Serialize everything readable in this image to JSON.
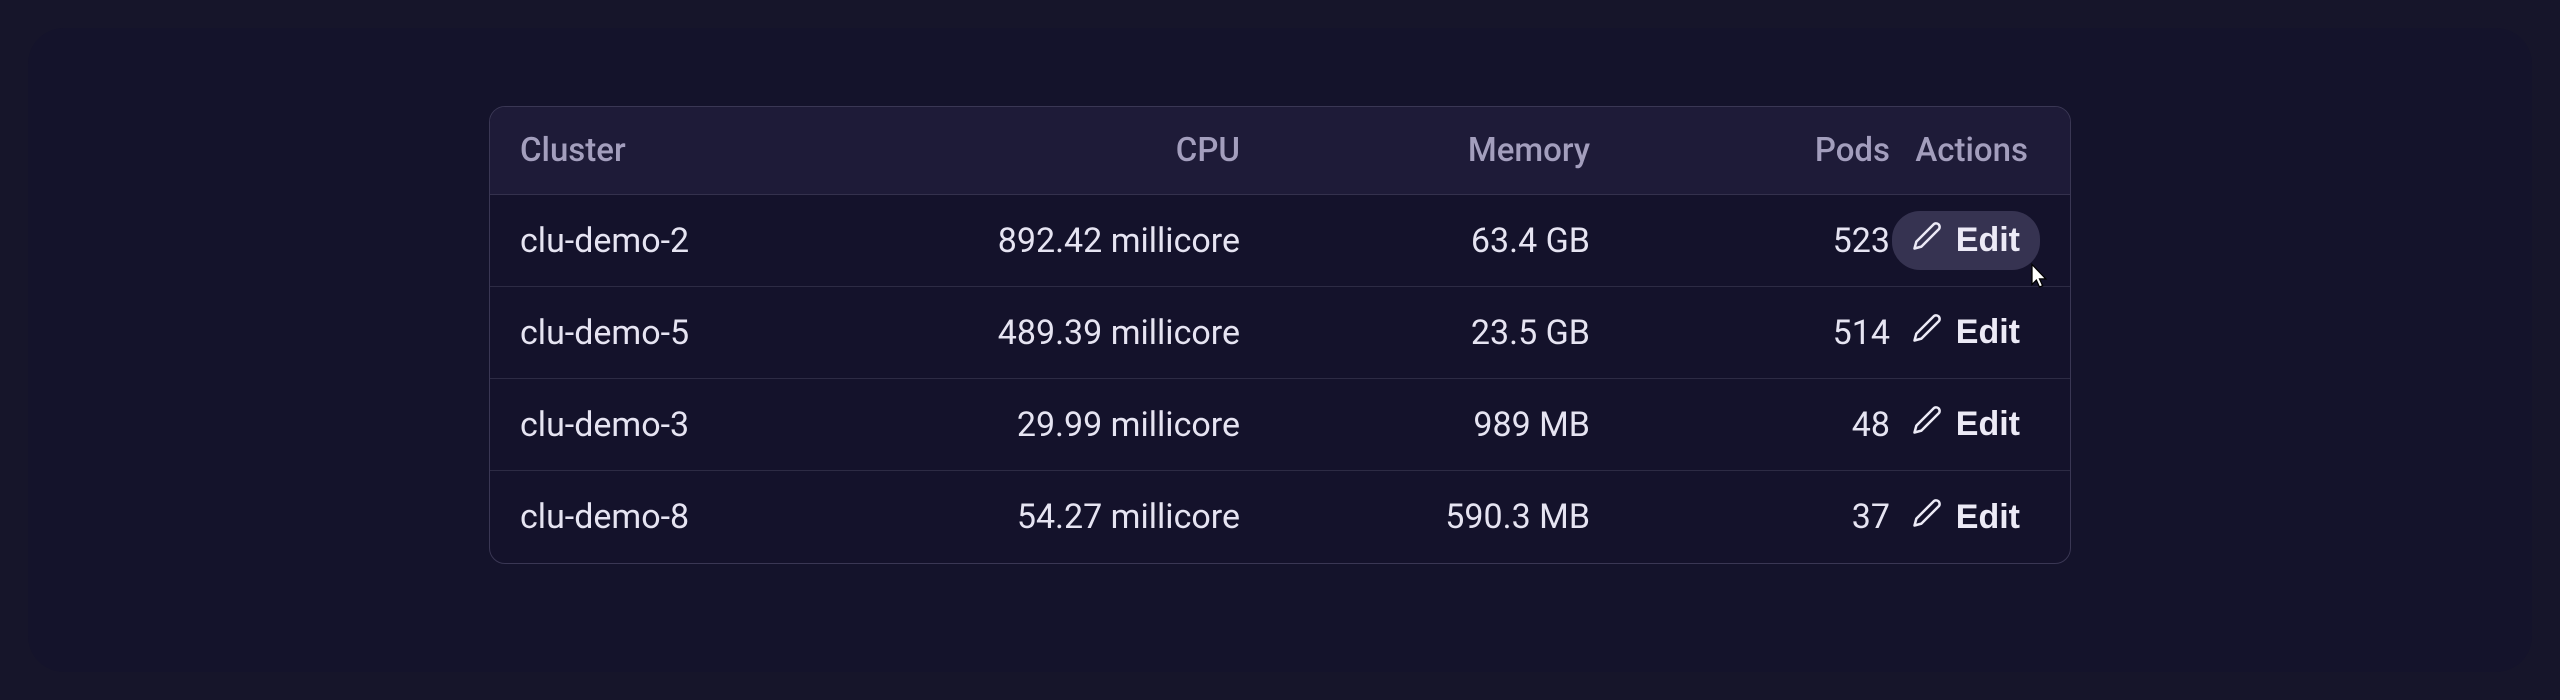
{
  "table": {
    "headers": {
      "cluster": "Cluster",
      "cpu": "CPU",
      "memory": "Memory",
      "pods": "Pods",
      "actions": "Actions"
    },
    "edit_label": "Edit",
    "rows": [
      {
        "cluster": "clu-demo-2",
        "cpu": "892.42 millicore",
        "memory": "63.4 GB",
        "pods": "523",
        "hovered": true
      },
      {
        "cluster": "clu-demo-5",
        "cpu": "489.39 millicore",
        "memory": "23.5 GB",
        "pods": "514",
        "hovered": false
      },
      {
        "cluster": "clu-demo-3",
        "cpu": "29.99 millicore",
        "memory": "989 MB",
        "pods": "48",
        "hovered": false
      },
      {
        "cluster": "clu-demo-8",
        "cpu": "54.27 millicore",
        "memory": "590.3 MB",
        "pods": "37",
        "hovered": false
      }
    ]
  }
}
